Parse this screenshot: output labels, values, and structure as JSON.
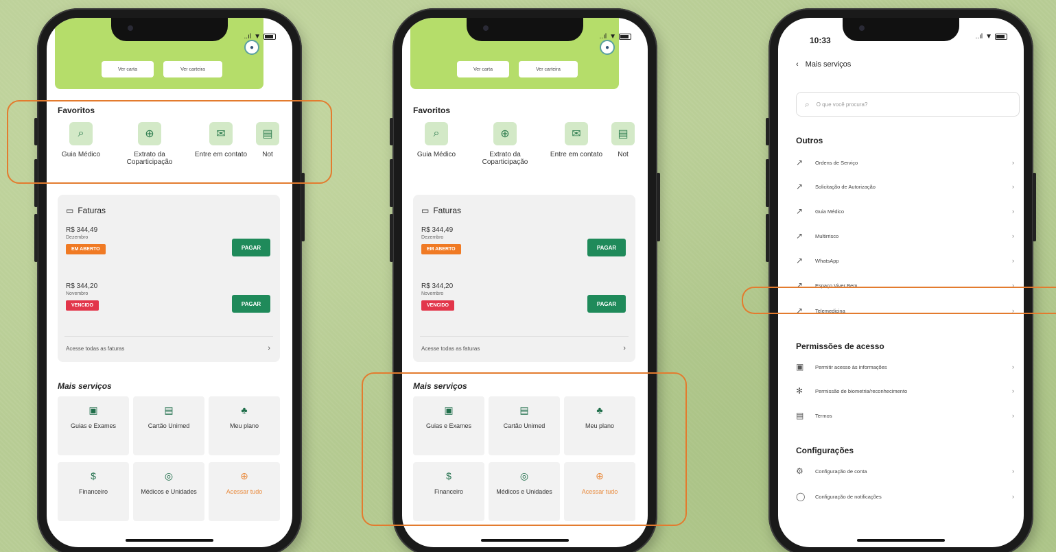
{
  "phone1": {
    "hero_buttons": [
      "Ver carta",
      "Ver carteira"
    ],
    "favorites_title": "Favoritos",
    "favorites": [
      "Guia Médico",
      "Extrato da Coparticipação",
      "Entre em contato",
      "Not"
    ],
    "invoices": {
      "title": "Faturas",
      "items": [
        {
          "value": "R$ 344,49",
          "month": "Dezembro",
          "status": "EM ABERTO",
          "status_color": "#f07a24",
          "action": "PAGAR"
        },
        {
          "value": "R$ 344,20",
          "month": "Novembro",
          "status": "VENCIDO",
          "status_color": "#e2364a",
          "action": "PAGAR"
        }
      ],
      "see_all": "Acesse todas as faturas"
    },
    "more_title": "Mais serviços",
    "services": [
      "Guias e Exames",
      "Cartão Unimed",
      "Meu plano",
      "Financeiro",
      "Médicos e Unidades",
      "Acessar tudo"
    ]
  },
  "phone3": {
    "time": "10:33",
    "header_title": "Mais serviços",
    "search_placeholder": "O que você procura?",
    "groups": [
      {
        "title": "Outros",
        "items": [
          "Ordens de Serviço",
          "Solicitação de Autorização",
          "Guia Médico",
          "Multirrisco",
          "WhatsApp",
          "Espaço Viver Bem",
          "Telemedicina"
        ]
      },
      {
        "title": "Permissões de acesso",
        "items": [
          "Permitir acesso às informações",
          "Permissão de biometria/reconhecimento",
          "Termos"
        ]
      },
      {
        "title": "Configurações",
        "items": [
          "Configuração de conta",
          "Configuração de notificações"
        ]
      }
    ]
  },
  "status": {
    "signal": "..ıl",
    "wifi": "▼"
  }
}
